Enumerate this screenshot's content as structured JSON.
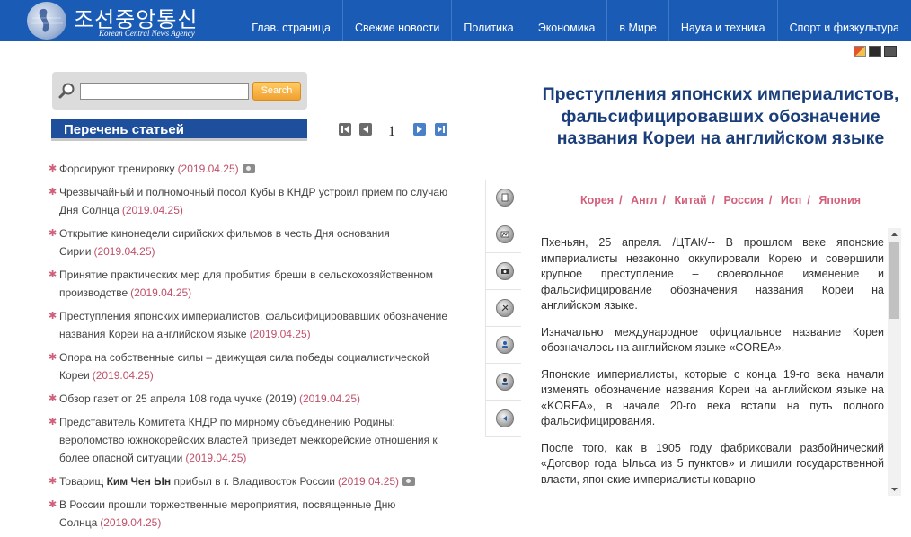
{
  "header": {
    "logo_text": "조선중앙통신",
    "logo_sub": "Korean Central News Agency",
    "nav": [
      "Глав. страница",
      "Свежие новости",
      "Политика",
      "Экономика",
      "в Мире",
      "Наука и техника",
      "Спорт и физкультура"
    ]
  },
  "search": {
    "placeholder": "",
    "value": "",
    "button_label": "Search"
  },
  "list": {
    "header": "Перечень статьей",
    "page_number": "1",
    "articles": [
      {
        "title": "Форсируют тренировку",
        "date": "(2019.04.25)",
        "camera": true
      },
      {
        "title": "Чрезвычайный и полномочный посол Кубы в КНДР устроил прием по случаю Дня Солнца",
        "date": "(2019.04.25)",
        "camera": false
      },
      {
        "title": "Открытие кинонедели сирийских фильмов в честь Дня основания Сирии",
        "date": "(2019.04.25)",
        "camera": false
      },
      {
        "title": "Принятие практических мер для пробития бреши в сельскохозяйственном производстве",
        "date": "(2019.04.25)",
        "camera": false
      },
      {
        "title": "Преступления японских империалистов, фальсифицировавших обозначение названия Кореи на английском языке",
        "date": "(2019.04.25)",
        "camera": false
      },
      {
        "title": "Опора на собственные силы – движущая сила победы социалистической Кореи",
        "date": "(2019.04.25)",
        "camera": false
      },
      {
        "title": "Обзор газет от 25 апреля 108 года чучхе (2019)",
        "date": "(2019.04.25)",
        "camera": false
      },
      {
        "title": "Представитель Комитета КНДР по мирному объединению Родины: вероломство южнокорейских властей приведет межкорейские отношения к более опасной ситуации",
        "date": "(2019.04.25)",
        "camera": false
      },
      {
        "title_prefix": "Товарищ ",
        "title_bold": "Ким Чен Ын",
        "title_suffix": " прибыл в г. Владивосток России",
        "date": "(2019.04.25)",
        "camera": true
      },
      {
        "title": "В России прошли торжественные мероприятия, посвященные Дню Солнца",
        "date": "(2019.04.25)",
        "camera": false
      }
    ]
  },
  "toolbar_icons": [
    "document-icon",
    "photo-icon",
    "camera-icon",
    "tools-icon",
    "person-add-icon",
    "person-icon",
    "back-icon"
  ],
  "article": {
    "headline": "Преступления японских империалистов, фальсифицировавших обозначение названия Кореи на английском языке",
    "languages": [
      "Корея",
      "Англ",
      "Китай",
      "Россия",
      "Исп",
      "Япония"
    ],
    "paragraphs": [
      "Пхеньян, 25 апреля. /ЦТАК/-- В прошлом веке японские империалисты незаконно оккупировали Корею и совершили крупное преступление – своевольное изменение и фальсифицирование обозначения названия Кореи на английском языке.",
      "Изначально международное официальное название Кореи обозначалось на английском языке «COREA».",
      "Японские империалисты, которые с конца 19-го века начали изменять обозначение названия Кореи на английском языке на «KOREA», в начале 20-го века встали на путь полного фальсифицирования.",
      "После того, как в 1905 году фабриковали разбойнический «Договор года Ыльса из 5 пунктов» и лишили государственной власти, японские империалисты коварно"
    ]
  },
  "colors": {
    "header_bg": "#1a5bb5",
    "list_header_bg": "#1e4f9c",
    "headline": "#1a3e7a",
    "date": "#c0506a",
    "language_link": "#d2607c",
    "search_button": "#f0a030"
  }
}
